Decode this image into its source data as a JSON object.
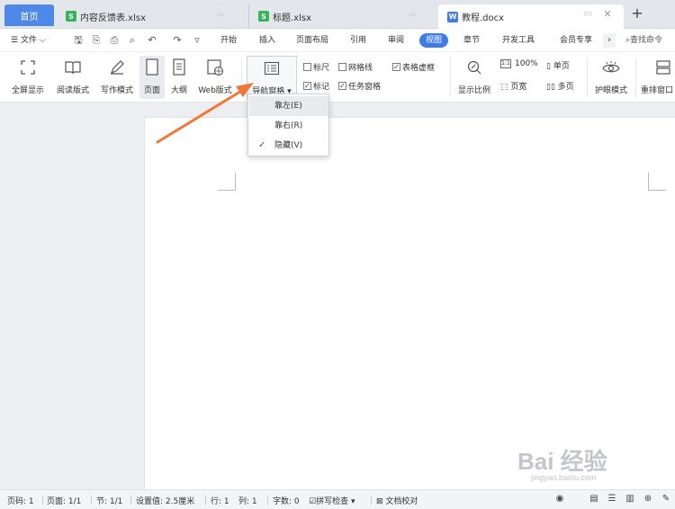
{
  "tabs": {
    "home": "首页",
    "items": [
      {
        "label": "内容反馈表.xlsx",
        "icon": "S"
      },
      {
        "label": "标题.xlsx",
        "icon": "S"
      },
      {
        "label": "教程.docx",
        "icon": "W"
      }
    ],
    "add": "+"
  },
  "menubar": {
    "file": "文件",
    "items": [
      "开始",
      "插入",
      "页面布局",
      "引用",
      "审阅",
      "视图",
      "章节",
      "开发工具",
      "会员专享"
    ],
    "active": "视图",
    "search": "查找命令"
  },
  "ribbon": {
    "fullscreen": "全屏显示",
    "read_mode": "阅读版式",
    "write_mode": "写作模式",
    "page": "页面",
    "outline": "大纲",
    "web": "Web版式",
    "nav_pane": "导航窗格",
    "ruler": "标尺",
    "gridlines": "网格线",
    "table_border": "表格虚框",
    "markup": "标记",
    "task_pane": "任务窗格",
    "display_ratio": "显示比例",
    "zoom_100": "100%",
    "single_page": "单页",
    "page_width": "页宽",
    "multi_page": "多页",
    "eye_mode": "护眼模式",
    "rearrange": "重排窗口",
    "checked": {
      "ruler": false,
      "gridlines": false,
      "table_border": true,
      "markup": true,
      "task_pane": true
    }
  },
  "dropdown": {
    "items": [
      "靠左(E)",
      "靠右(R)",
      "隐藏(V)"
    ],
    "highlighted": "靠左(E)",
    "checked": "隐藏(V)"
  },
  "statusbar": {
    "page_no": "页码: 1",
    "pages": "页面: 1/1",
    "section": "节: 1/1",
    "position": "设置值: 2.5厘米",
    "line": "行: 1",
    "column": "列: 1",
    "words": "字数: 0",
    "spell_check": "拼写检查",
    "doc_check": "文档校对"
  },
  "watermark": {
    "text": "Bai 经验",
    "sub": "jingyan.baidu.com"
  },
  "colors": {
    "accent": "#3f7ce8",
    "home_tab": "#4e88e8",
    "arrow": "#f07838",
    "sheet_icon": "#35b558"
  }
}
